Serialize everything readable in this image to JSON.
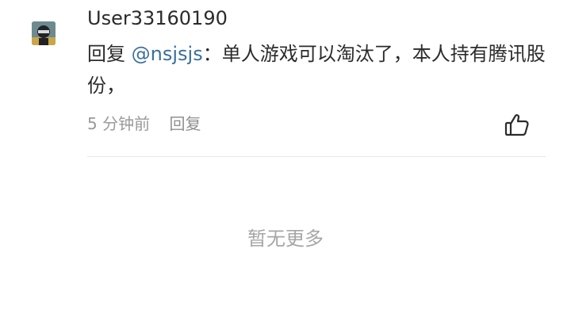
{
  "comment": {
    "username": "User33160190",
    "reply_prefix": "回复 ",
    "mention": "@nsjsjs",
    "text": "：单人游戏可以淘汰了，本人持有腾讯股份，",
    "time": "5 分钟前",
    "reply_label": "回复",
    "like_icon": "thumbs-up-icon",
    "avatar_icon": "user-avatar"
  },
  "footer": {
    "empty_text": "暂无更多"
  }
}
